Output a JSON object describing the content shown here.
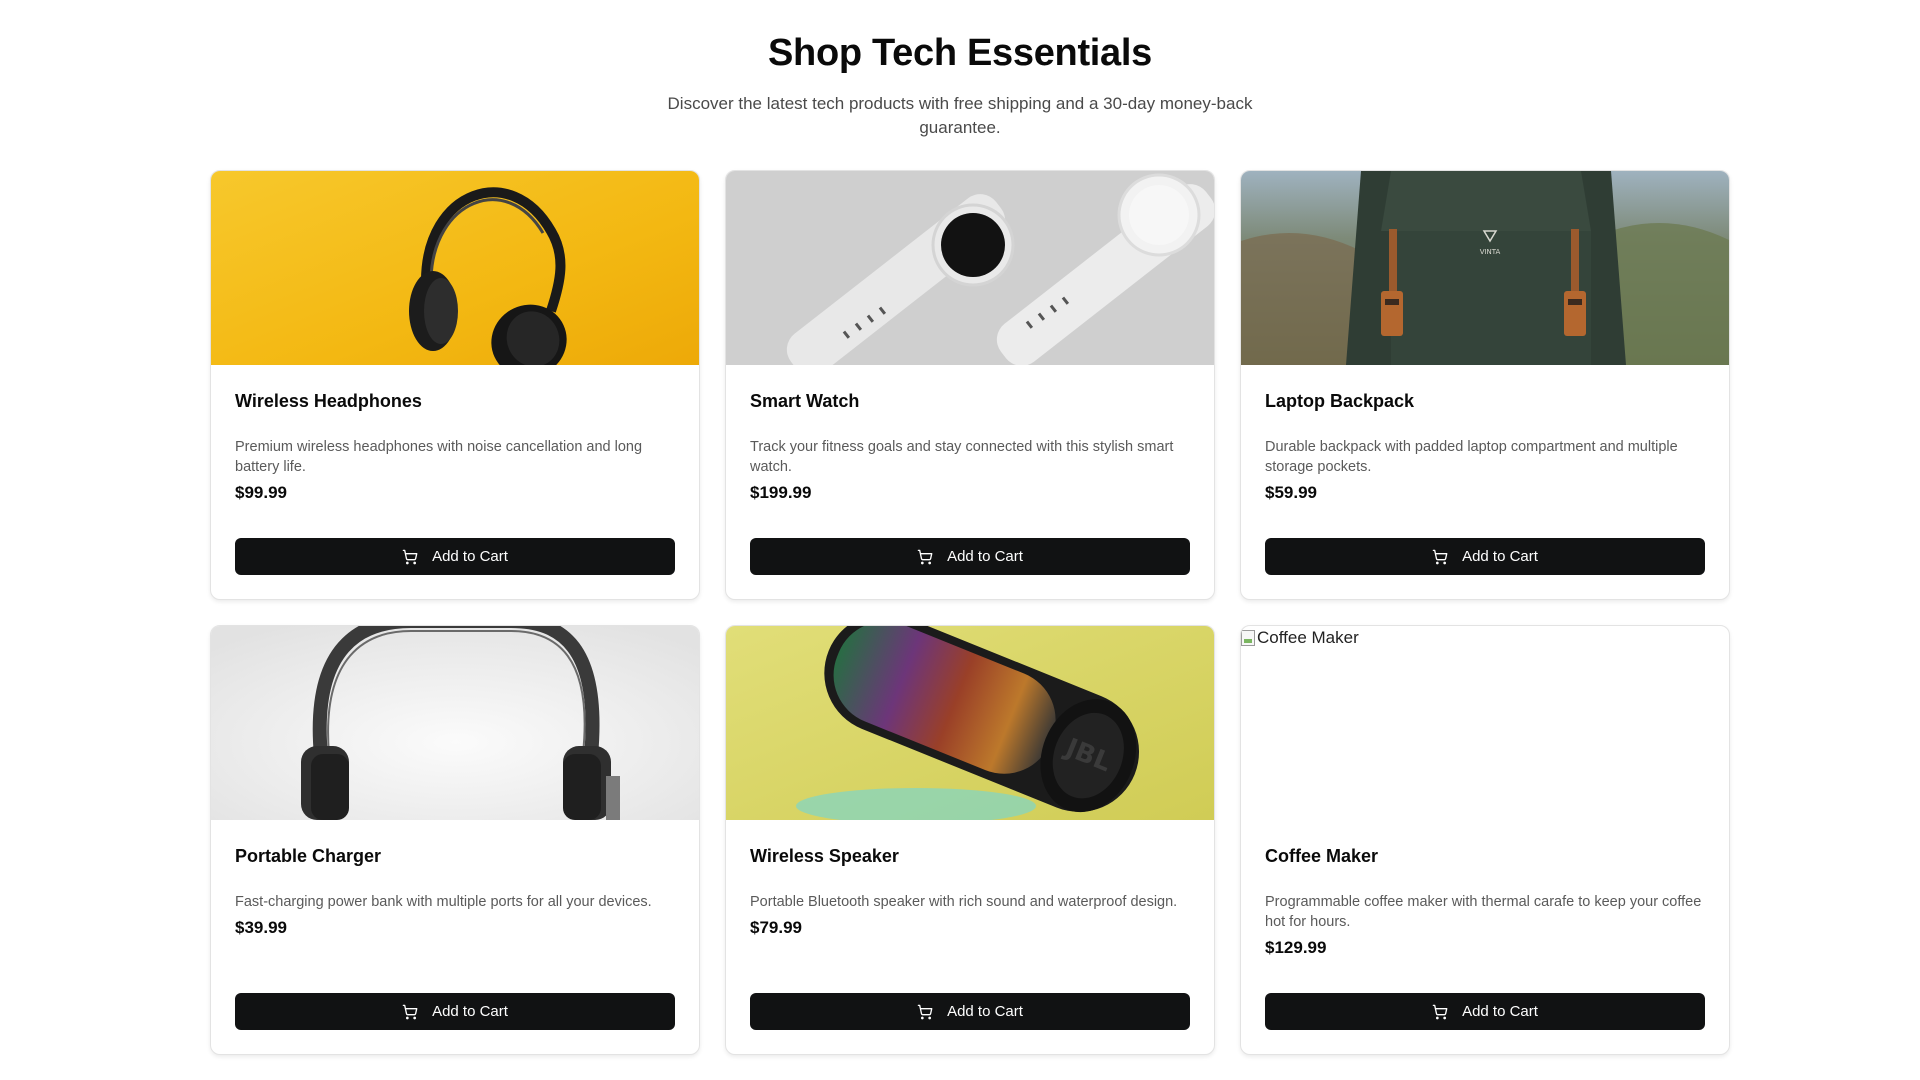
{
  "header": {
    "title": "Shop Tech Essentials",
    "subtitle": "Discover the latest tech products with free shipping and a 30-day money-back guarantee."
  },
  "products": [
    {
      "name": "Wireless Headphones",
      "description": "Premium wireless headphones with noise cancellation and long battery life.",
      "price": "$99.99",
      "button": "Add to Cart",
      "image": "headphones-on-yellow"
    },
    {
      "name": "Smart Watch",
      "description": "Track your fitness goals and stay connected with this stylish smart watch.",
      "price": "$199.99",
      "button": "Add to Cart",
      "image": "white-smartwatches"
    },
    {
      "name": "Laptop Backpack",
      "description": "Durable backpack with padded laptop compartment and multiple storage pockets.",
      "price": "$59.99",
      "button": "Add to Cart",
      "image": "green-backpack-mountains",
      "image_brand_text": "VINTA"
    },
    {
      "name": "Portable Charger",
      "description": "Fast-charging power bank with multiple ports for all your devices.",
      "price": "$39.99",
      "button": "Add to Cart",
      "image": "gray-headphones-on-white"
    },
    {
      "name": "Wireless Speaker",
      "description": "Portable Bluetooth speaker with rich sound and waterproof design.",
      "price": "$79.99",
      "button": "Add to Cart",
      "image": "jbl-speaker-on-yellow",
      "image_brand_text": "JBL"
    },
    {
      "name": "Coffee Maker",
      "description": "Programmable coffee maker with thermal carafe to keep your coffee hot for hours.",
      "price": "$129.99",
      "button": "Add to Cart",
      "image": "broken-image",
      "image_alt": "Coffee Maker"
    }
  ],
  "icons": {
    "cart": "shopping-cart-icon"
  },
  "colors": {
    "button_bg": "#111213",
    "button_text": "#ffffff",
    "description_text": "#5a5a5a"
  }
}
